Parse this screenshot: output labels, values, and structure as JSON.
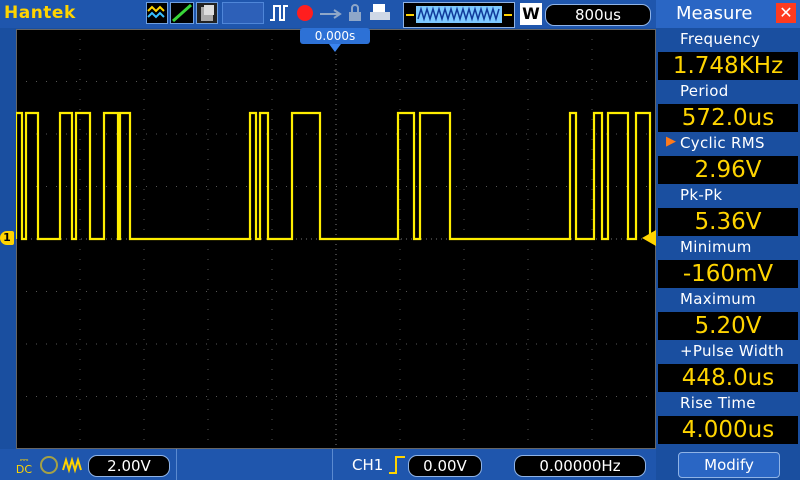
{
  "brand": "Hantek",
  "timebase": "800us",
  "wave_badge": "W",
  "trigger_position": "0.000s",
  "measure": {
    "title": "Measure",
    "items": [
      {
        "label": "Frequency",
        "value": "1.748KHz"
      },
      {
        "label": "Period",
        "value": "572.0us"
      },
      {
        "label": "Cyclic RMS",
        "value": "2.96V"
      },
      {
        "label": "Pk-Pk",
        "value": "5.36V"
      },
      {
        "label": "Minimum",
        "value": "-160mV"
      },
      {
        "label": "Maximum",
        "value": "5.20V"
      },
      {
        "label": "+Pulse Width",
        "value": "448.0us"
      },
      {
        "label": "Rise Time",
        "value": "4.000us"
      }
    ],
    "selected_marker": "▶",
    "modify_label": "Modify"
  },
  "bottom": {
    "volts_div": "2.00V",
    "channel": "CH1",
    "trigger_level": "0.00V",
    "trigger_freq": "0.00000Hz"
  },
  "channel_marker": "1",
  "colors": {
    "trace": "#ffee00",
    "accent": "#ffd400"
  }
}
